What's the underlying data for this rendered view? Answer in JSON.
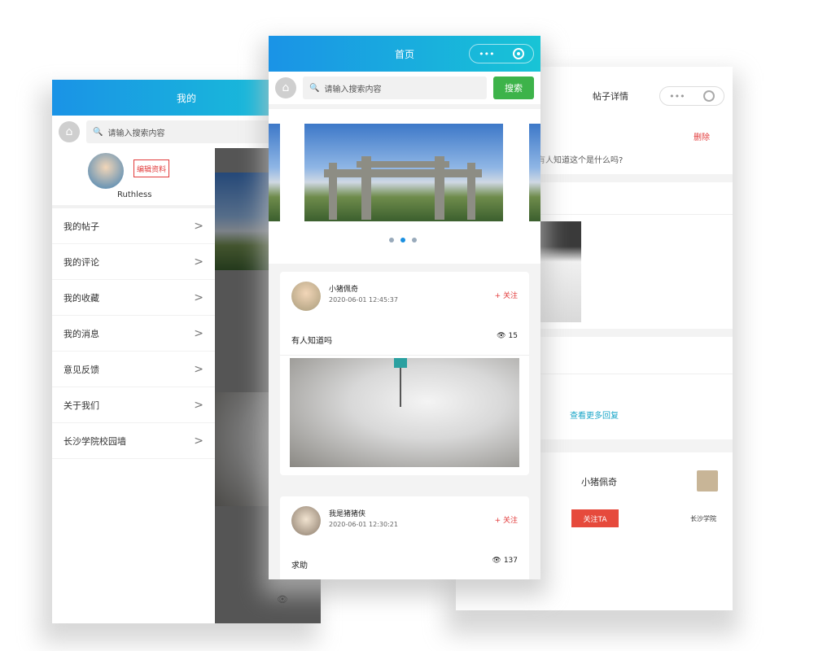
{
  "left_phone": {
    "title": "我的",
    "search_placeholder": "请输入搜索内容",
    "profile_button": "编辑资料",
    "username": "Ruthless",
    "menu": [
      {
        "label": "我的帖子"
      },
      {
        "label": "我的评论"
      },
      {
        "label": "我的收藏"
      },
      {
        "label": "我的消息"
      },
      {
        "label": "意见反馈"
      },
      {
        "label": "关于我们"
      },
      {
        "label": "长沙学院校园墙"
      }
    ]
  },
  "center_phone": {
    "title": "首页",
    "capsule_more": "•••",
    "search_placeholder": "请输入搜索内容",
    "search_button": "搜索",
    "carousel_dots": 3,
    "posts": [
      {
        "author": "小猪佩奇",
        "time": "2020-06-01 12:45:37",
        "follow": "+ 关注",
        "text": "有人知道吗",
        "views": "15"
      },
      {
        "author": "我是猪猪侠",
        "time": "2020-06-01 12:30:21",
        "follow": "+ 关注",
        "text": "求助",
        "views": "137"
      }
    ]
  },
  "right_phone": {
    "title": "帖子详情",
    "capsule_more": "•••",
    "delete_label": "删除",
    "post_text": "有人知道这个是什么吗?",
    "link_text": "查看更多回复",
    "author": "小猪佩奇",
    "button": "关注TA",
    "footer": "长沙学院"
  },
  "colors": {
    "nav_start": "#1a93e6",
    "nav_end": "#18c4d6",
    "green": "#3db34a",
    "red": "#e23b3b",
    "link": "#1aa6c8"
  }
}
